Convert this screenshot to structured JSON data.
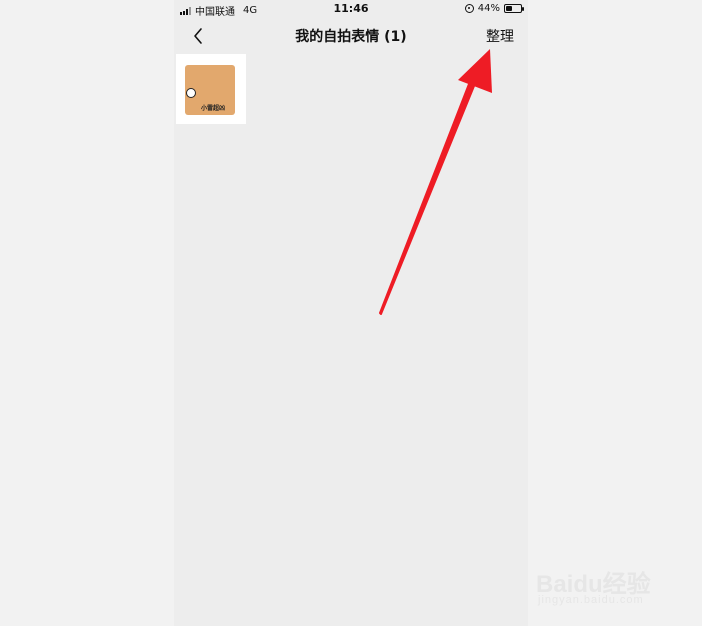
{
  "status_bar": {
    "carrier": "中国联通",
    "network": "4G",
    "time": "11:46",
    "battery_text": "44%",
    "battery_level": 0.44
  },
  "nav": {
    "title": "我的自拍表情 (1)",
    "organize_label": "整理",
    "back_icon": "chevron-left-icon"
  },
  "stickers": [
    {
      "caption": "小雷超凶",
      "color": "#e2a86d"
    }
  ],
  "colors": {
    "background": "#ededed",
    "arrow": "#ee1c25"
  },
  "watermark": {
    "brand": "Baidu经验",
    "url": "jingyan.baidu.com"
  }
}
